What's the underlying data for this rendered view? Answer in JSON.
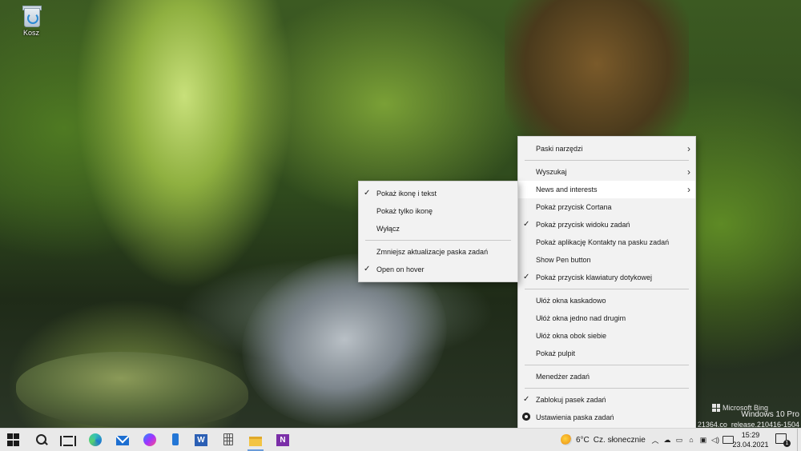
{
  "desktop": {
    "icons": [
      {
        "label": "Kosz",
        "icon": "recycle-bin-icon"
      }
    ],
    "watermark": {
      "bing": "Microsoft Bing",
      "edition": "Windows 10 Pro",
      "build": "Build 21364.co_release.210416-1504"
    }
  },
  "main_menu": {
    "items": [
      {
        "label": "Paski narzędzi",
        "submenu": true
      },
      {
        "label": "Wyszukaj",
        "submenu": true
      },
      {
        "label": "News and interests",
        "submenu": true,
        "highlighted": true
      },
      {
        "label": "Pokaż przycisk Cortana"
      },
      {
        "label": "Pokaż przycisk widoku zadań",
        "checked": true
      },
      {
        "label": "Pokaż aplikację Kontakty na pasku zadań"
      },
      {
        "label": "Show Pen button"
      },
      {
        "label": "Pokaż przycisk klawiatury dotykowej",
        "checked": true
      },
      {
        "label": "Ułóż okna kaskadowo"
      },
      {
        "label": "Ułóż okna jedno nad drugim"
      },
      {
        "label": "Ułóż okna obok siebie"
      },
      {
        "label": "Pokaż pulpit"
      },
      {
        "label": "Menedżer zadań"
      },
      {
        "label": "Zablokuj pasek zadań",
        "checked": true
      },
      {
        "label": "Ustawienia paska zadań",
        "icon": "gear-icon"
      }
    ]
  },
  "submenu": {
    "items": [
      {
        "label": "Pokaż ikonę i tekst",
        "checked": true
      },
      {
        "label": "Pokaż tylko ikonę"
      },
      {
        "label": "Wyłącz"
      },
      {
        "label": "Zmniejsz aktualizacje paska zadań"
      },
      {
        "label": "Open on hover",
        "checked": true
      }
    ]
  },
  "taskbar": {
    "apps": [
      "start-button",
      "search-button",
      "task-view-button",
      "edge-canary",
      "mail",
      "messenger",
      "phone-link",
      "word",
      "calculator",
      "file-explorer",
      "onenote"
    ],
    "weather": {
      "temp": "6°C",
      "condition": "Cz. słonecznie"
    },
    "clock": {
      "time": "15:29",
      "date": "23.04.2021"
    },
    "notifications": "1"
  },
  "colors": {
    "menu_bg": "#f2f2f2",
    "menu_highlight": "#ffffff",
    "taskbar_bg": "#e9e9e9"
  }
}
